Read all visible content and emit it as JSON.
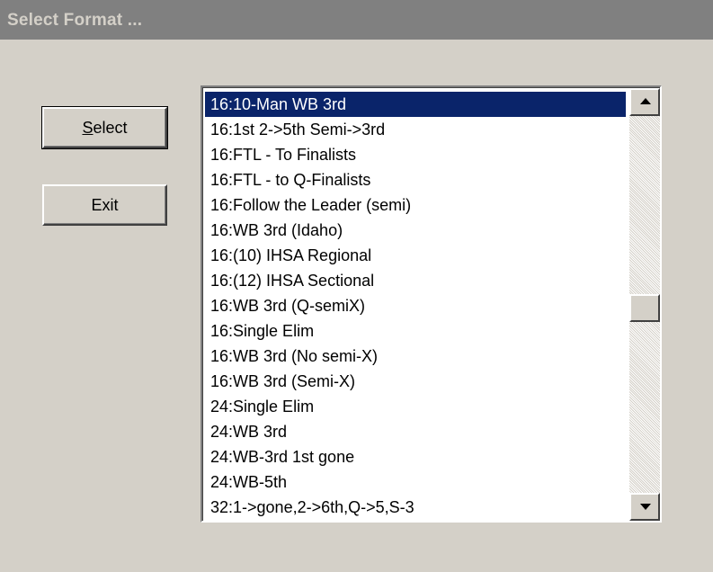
{
  "window": {
    "title": "Select Format ..."
  },
  "buttons": {
    "select": {
      "mnemonic": "S",
      "rest": "elect"
    },
    "exit": "Exit"
  },
  "formats": {
    "selected_index": 0,
    "items": [
      "16:10-Man WB 3rd",
      "16:1st 2->5th Semi->3rd",
      "16:FTL - To Finalists",
      "16:FTL - to Q-Finalists",
      "16:Follow the Leader (semi)",
      "16:WB 3rd (Idaho)",
      "16:(10) IHSA Regional",
      "16:(12) IHSA Sectional",
      "16:WB 3rd (Q-semiX)",
      "16:Single Elim",
      "16:WB 3rd (No semi-X)",
      "16:WB 3rd (Semi-X)",
      "24:Single Elim",
      "24:WB 3rd",
      "24:WB-3rd 1st gone",
      "24:WB-5th",
      "32:1->gone,2->6th,Q->5,S-3"
    ]
  },
  "icons": {
    "scroll_up": "arrow-up-icon",
    "scroll_down": "arrow-down-icon"
  },
  "colors": {
    "window_bg": "#d4d0c8",
    "titlebar_bg": "#808080",
    "selection_bg": "#0a246a",
    "selection_text": "#ffffff"
  }
}
